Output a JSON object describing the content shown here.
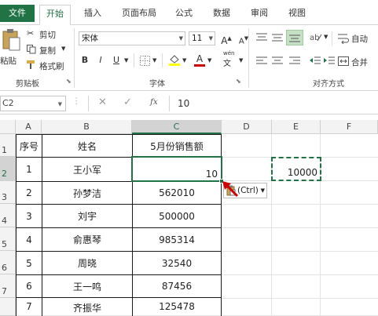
{
  "tabs": [
    "文件",
    "开始",
    "插入",
    "页面布局",
    "公式",
    "数据",
    "审阅",
    "视图"
  ],
  "ribbon": {
    "paste_label": "粘贴",
    "cut_label": "剪切",
    "copy_label": "复制",
    "format_painter_label": "格式刷",
    "clipboard_group": "剪贴板",
    "font_name": "宋体",
    "font_size": "11",
    "grow_font": "A",
    "shrink_font": "A",
    "bold": "B",
    "italic": "I",
    "underline": "U",
    "font_color_letter": "A",
    "phonetic_label": "wén",
    "phonetic_glyph": "文",
    "font_group": "字体",
    "wrap_text_label": "自动",
    "merge_label": "合并",
    "alignment_group": "对齐方式"
  },
  "formula_bar": {
    "name_box": "C2",
    "fx_label": "fx",
    "value": "10"
  },
  "colors": {
    "accent": "#217346",
    "grid_line": "#e3e3e3",
    "table_border": "#1a1a1a",
    "paste_arrow": "#d00000"
  },
  "columns": [
    "A",
    "B",
    "C",
    "D",
    "E",
    "F"
  ],
  "rows": [
    "1",
    "2",
    "3",
    "4",
    "5",
    "6",
    "7"
  ],
  "table": {
    "headers": [
      "序号",
      "姓名",
      "5月份销售额"
    ],
    "rows": [
      [
        "1",
        "王小军",
        "10"
      ],
      [
        "2",
        "孙梦洁",
        "562010"
      ],
      [
        "3",
        "刘宇",
        "500000"
      ],
      [
        "4",
        "俞惠琴",
        "985314"
      ],
      [
        "5",
        "周晓",
        "32540"
      ],
      [
        "6",
        "王一鸣",
        "87456"
      ],
      [
        "7",
        "齐振华",
        "125478"
      ]
    ]
  },
  "copied_cell": {
    "value": "10000"
  },
  "paste_options": {
    "label": "(Ctrl)"
  }
}
